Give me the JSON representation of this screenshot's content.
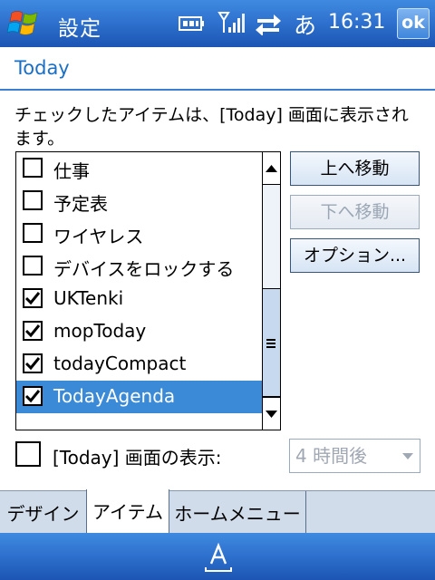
{
  "titlebar": {
    "app_title": "設定",
    "ime": "あ",
    "clock": "16:31",
    "ok_label": "ok"
  },
  "header": {
    "title": "Today"
  },
  "description": "チェックしたアイテムは、[Today] 画面に表示されます。",
  "items": [
    {
      "label": "仕事",
      "checked": false,
      "selected": false
    },
    {
      "label": "予定表",
      "checked": false,
      "selected": false
    },
    {
      "label": "ワイヤレス",
      "checked": false,
      "selected": false
    },
    {
      "label": "デバイスをロックする",
      "checked": false,
      "selected": false
    },
    {
      "label": "UKTenki",
      "checked": true,
      "selected": false
    },
    {
      "label": "mopToday",
      "checked": true,
      "selected": false
    },
    {
      "label": "todayCompact",
      "checked": true,
      "selected": false
    },
    {
      "label": "TodayAgenda",
      "checked": true,
      "selected": true
    }
  ],
  "buttons": {
    "move_up": "上へ移動",
    "move_down": "下へ移動",
    "options": "オプション..."
  },
  "show_today": {
    "label": "[Today] 画面の表示:",
    "checked": false,
    "timeout_value": "4 時間後"
  },
  "tabs": [
    {
      "label": "デザイン",
      "active": false
    },
    {
      "label": "アイテム",
      "active": true
    },
    {
      "label": "ホームメニュー",
      "active": false
    }
  ],
  "colors": {
    "titlebar": "#2f72cf",
    "accent": "#1a6fc4",
    "selection": "#3b8ad7"
  }
}
